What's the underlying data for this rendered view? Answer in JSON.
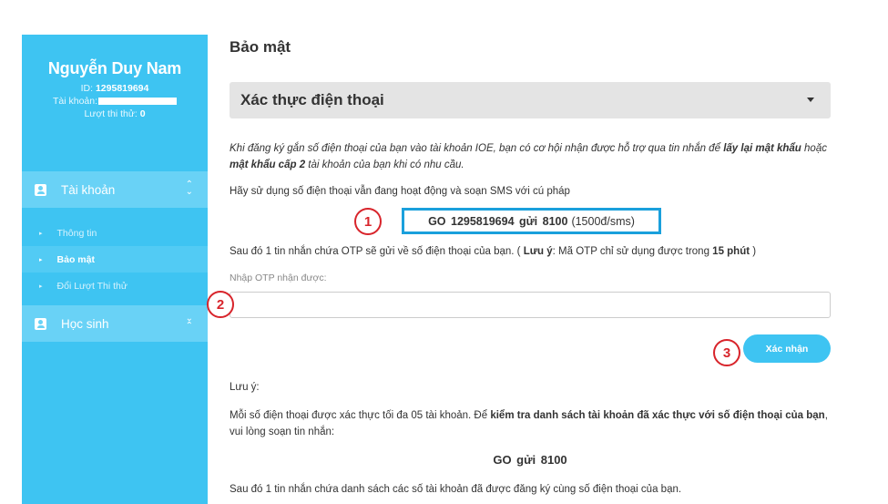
{
  "sidebar": {
    "user_name": "Nguyễn Duy Nam",
    "id_label": "ID: ",
    "id_value": "1295819694",
    "account_label": "Tài khoản:",
    "trials_label": "Lượt thi thử: ",
    "trials_value": "0",
    "menu_account": {
      "label": "Tài khoản",
      "icon": "id-badge-icon",
      "items": [
        {
          "label": "Thông tin",
          "active": false
        },
        {
          "label": "Bảo mật",
          "active": true
        },
        {
          "label": "Đổi Lượt Thi thử",
          "active": false
        }
      ]
    },
    "menu_student": {
      "label": "Học sinh",
      "icon": "id-badge-icon"
    }
  },
  "main": {
    "page_title": "Bảo mật",
    "dropdown_label": "Xác thực điện thoại",
    "intro_part1": "Khi đăng ký gắn số điện thoại của bạn vào tài khoản IOE, bạn có cơ hội nhận được hỗ trợ qua tin nhắn để ",
    "intro_bold1": "lấy lại mật khẩu",
    "intro_part2": " hoặc ",
    "intro_bold2": "mật khẩu cấp 2",
    "intro_part3": " tài khoản của bạn khi có nhu cầu.",
    "use_phone_text": "Hãy sử dụng số điện thoại vẫn đang hoạt động và soạn SMS với cú pháp",
    "sms_syntax": "GO  1295819694  gửi  8100",
    "sms_price": "(1500đ/sms)",
    "after_part1": "Sau đó 1 tin nhắn chứa OTP sẽ gửi về số điện thoại của bạn. ( ",
    "after_bold1": "Lưu ý",
    "after_part2": ": Mã OTP chỉ sử dụng được trong ",
    "after_bold2": "15 phút",
    "after_part3": " )",
    "otp_label": "Nhập OTP nhận được:",
    "otp_value": "",
    "confirm_button": "Xác nhận",
    "note_label": "Lưu ý:",
    "note_part1": "Mỗi số điện thoại được xác thực tối đa 05 tài khoản. Để ",
    "note_bold": "kiểm tra danh sách tài khoản đã xác thực với số điện thoại của bạn",
    "note_part2": ", vui lòng soạn tin nhắn:",
    "go_syntax": "GO  gửi  8100",
    "last_line": "Sau đó 1 tin nhắn chứa danh sách các số tài khoản đã được đăng ký cùng số điện thoại của bạn."
  },
  "markers": [
    "1",
    "2",
    "3"
  ],
  "colors": {
    "sidebar_bg": "#3ec4f2",
    "menu_head_bg": "#69d2f6",
    "highlight_border": "#1aa0dc",
    "marker_red": "#d8242b",
    "button_bg": "#3ec4f2"
  }
}
